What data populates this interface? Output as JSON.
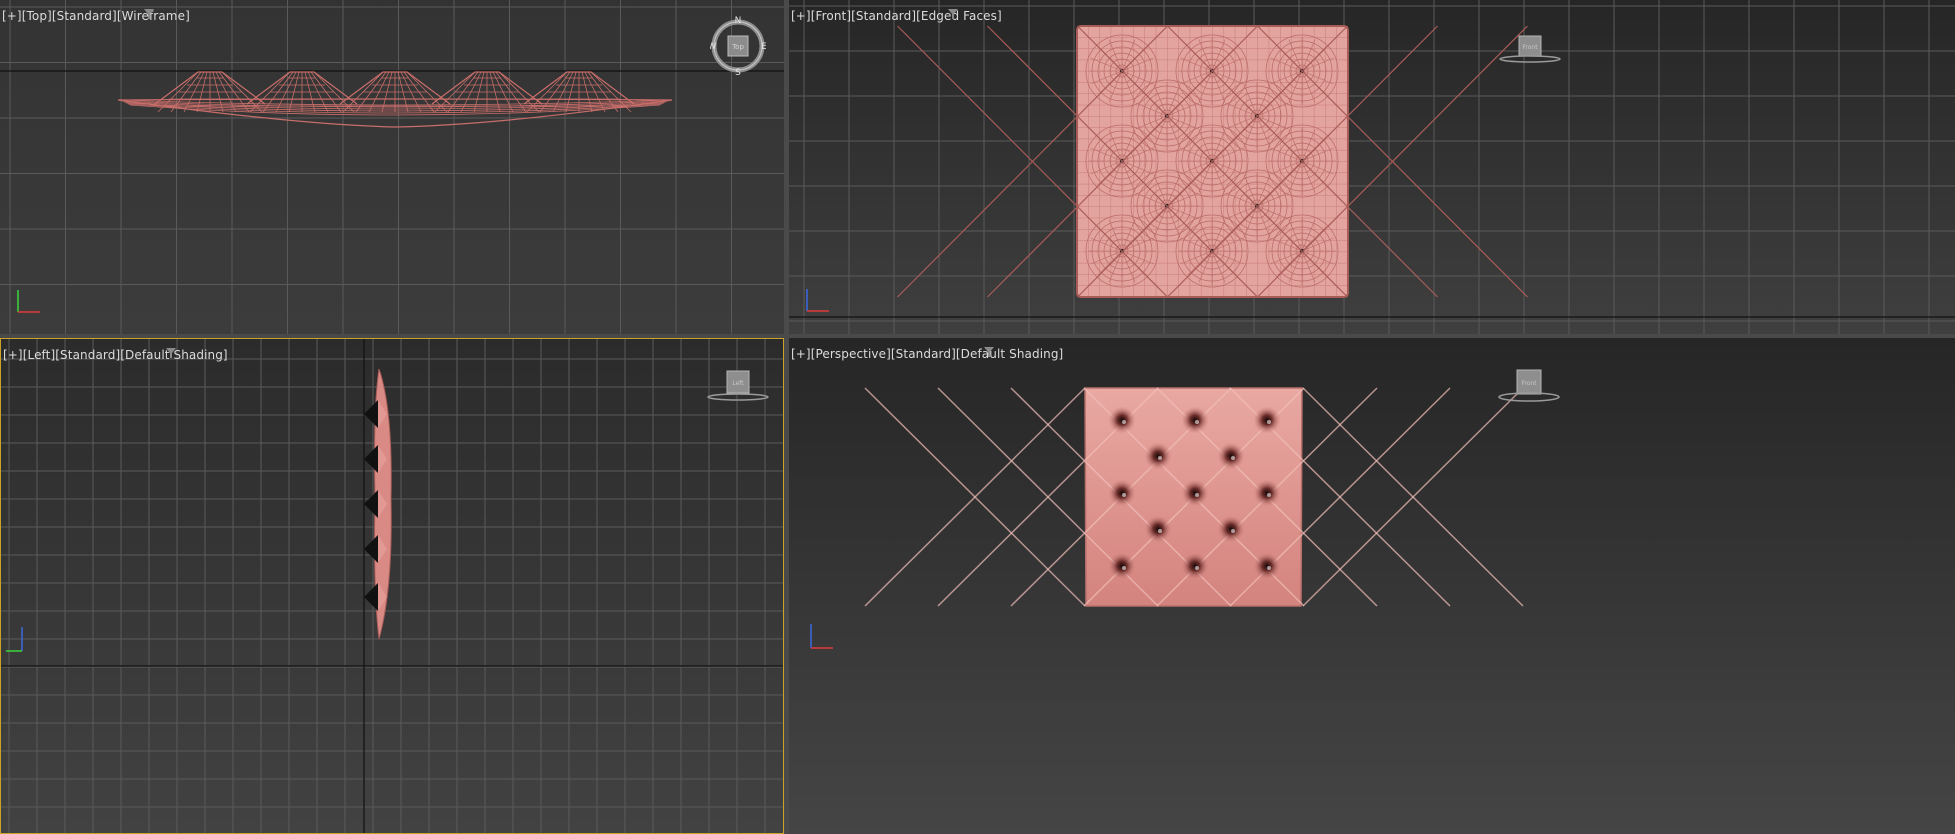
{
  "viewports": {
    "top": {
      "labels": [
        "[+]",
        "[Top]",
        "[Standard]",
        "[Wireframe]"
      ],
      "compass": {
        "n": "N",
        "s": "S",
        "e": "E",
        "w": "W",
        "cube": "Top"
      }
    },
    "front": {
      "labels": [
        "[+]",
        "[Front]",
        "[Standard]",
        "[Edged Faces]"
      ],
      "cube": "Front"
    },
    "left": {
      "labels": [
        "[+]",
        "[Left]",
        "[Standard]",
        "[Default Shading]"
      ],
      "cube": "Left"
    },
    "perspective": {
      "labels": [
        "[+]",
        "[Perspective]",
        "[Standard]",
        "[Default Shading]"
      ],
      "cube": "Front"
    }
  },
  "colors": {
    "grid_line": "#5a5a5a",
    "object": "#d98a85",
    "wire": "#c96e6a",
    "active_border": "#c9a227",
    "axis_x": "#e03a3a",
    "axis_y": "#3ad63a",
    "axis_z": "#3a6ae0"
  },
  "icons": [
    "filter-icon",
    "compass-icon",
    "viewcube-icon",
    "axis-tripod-icon"
  ]
}
